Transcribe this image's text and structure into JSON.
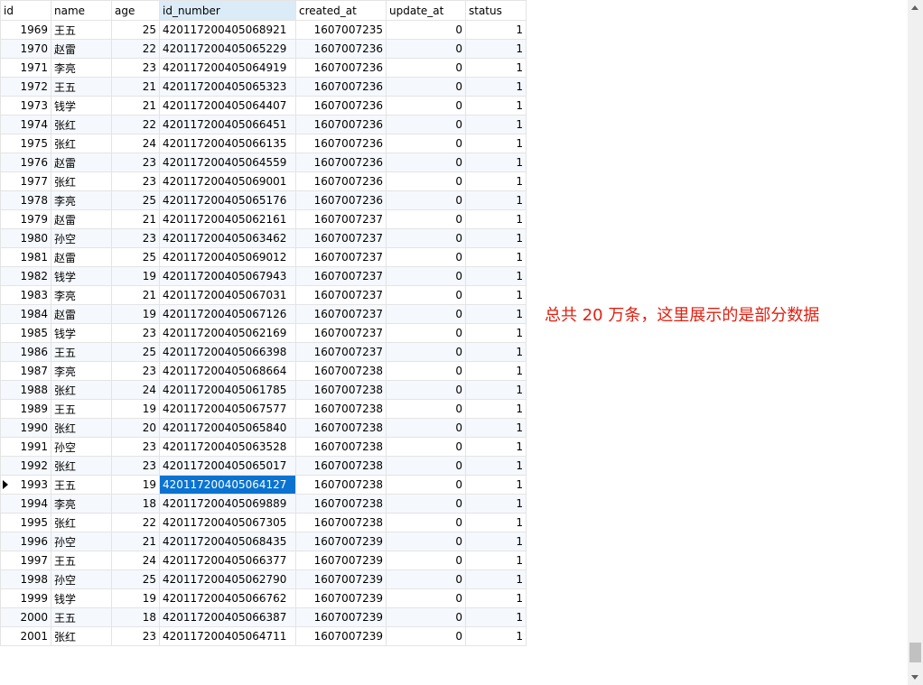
{
  "grid": {
    "columns": [
      "id",
      "name",
      "age",
      "id_number",
      "created_at",
      "update_at",
      "status"
    ],
    "sorted_column_index": 3,
    "current_row_index": 24,
    "selected_cell": {
      "row": 24,
      "col": 3
    },
    "rows": [
      [
        "1969",
        "王五",
        "25",
        "420117200405068921",
        "1607007235",
        "0",
        "1"
      ],
      [
        "1970",
        "赵雷",
        "22",
        "420117200405065229",
        "1607007236",
        "0",
        "1"
      ],
      [
        "1971",
        "李亮",
        "23",
        "420117200405064919",
        "1607007236",
        "0",
        "1"
      ],
      [
        "1972",
        "王五",
        "21",
        "420117200405065323",
        "1607007236",
        "0",
        "1"
      ],
      [
        "1973",
        "钱学",
        "21",
        "420117200405064407",
        "1607007236",
        "0",
        "1"
      ],
      [
        "1974",
        "张红",
        "22",
        "420117200405066451",
        "1607007236",
        "0",
        "1"
      ],
      [
        "1975",
        "张红",
        "24",
        "420117200405066135",
        "1607007236",
        "0",
        "1"
      ],
      [
        "1976",
        "赵雷",
        "23",
        "420117200405064559",
        "1607007236",
        "0",
        "1"
      ],
      [
        "1977",
        "张红",
        "23",
        "420117200405069001",
        "1607007236",
        "0",
        "1"
      ],
      [
        "1978",
        "李亮",
        "25",
        "420117200405065176",
        "1607007236",
        "0",
        "1"
      ],
      [
        "1979",
        "赵雷",
        "21",
        "420117200405062161",
        "1607007237",
        "0",
        "1"
      ],
      [
        "1980",
        "孙空",
        "23",
        "420117200405063462",
        "1607007237",
        "0",
        "1"
      ],
      [
        "1981",
        "赵雷",
        "25",
        "420117200405069012",
        "1607007237",
        "0",
        "1"
      ],
      [
        "1982",
        "钱学",
        "19",
        "420117200405067943",
        "1607007237",
        "0",
        "1"
      ],
      [
        "1983",
        "李亮",
        "21",
        "420117200405067031",
        "1607007237",
        "0",
        "1"
      ],
      [
        "1984",
        "赵雷",
        "19",
        "420117200405067126",
        "1607007237",
        "0",
        "1"
      ],
      [
        "1985",
        "钱学",
        "23",
        "420117200405062169",
        "1607007237",
        "0",
        "1"
      ],
      [
        "1986",
        "王五",
        "25",
        "420117200405066398",
        "1607007237",
        "0",
        "1"
      ],
      [
        "1987",
        "李亮",
        "23",
        "420117200405068664",
        "1607007238",
        "0",
        "1"
      ],
      [
        "1988",
        "张红",
        "24",
        "420117200405061785",
        "1607007238",
        "0",
        "1"
      ],
      [
        "1989",
        "王五",
        "19",
        "420117200405067577",
        "1607007238",
        "0",
        "1"
      ],
      [
        "1990",
        "张红",
        "20",
        "420117200405065840",
        "1607007238",
        "0",
        "1"
      ],
      [
        "1991",
        "孙空",
        "23",
        "420117200405063528",
        "1607007238",
        "0",
        "1"
      ],
      [
        "1992",
        "张红",
        "23",
        "420117200405065017",
        "1607007238",
        "0",
        "1"
      ],
      [
        "1993",
        "王五",
        "19",
        "420117200405064127",
        "1607007238",
        "0",
        "1"
      ],
      [
        "1994",
        "李亮",
        "18",
        "420117200405069889",
        "1607007238",
        "0",
        "1"
      ],
      [
        "1995",
        "张红",
        "22",
        "420117200405067305",
        "1607007238",
        "0",
        "1"
      ],
      [
        "1996",
        "孙空",
        "21",
        "420117200405068435",
        "1607007239",
        "0",
        "1"
      ],
      [
        "1997",
        "王五",
        "24",
        "420117200405066377",
        "1607007239",
        "0",
        "1"
      ],
      [
        "1998",
        "孙空",
        "25",
        "420117200405062790",
        "1607007239",
        "0",
        "1"
      ],
      [
        "1999",
        "钱学",
        "19",
        "420117200405066762",
        "1607007239",
        "0",
        "1"
      ],
      [
        "2000",
        "王五",
        "18",
        "420117200405066387",
        "1607007239",
        "0",
        "1"
      ],
      [
        "2001",
        "张红",
        "23",
        "420117200405064711",
        "1607007239",
        "0",
        "1"
      ]
    ]
  },
  "annotation": {
    "text": "总共  20 万条，这里展示的是部分数据",
    "color": "#e02010"
  },
  "colors": {
    "selection": "#0a73d1",
    "sorted_header": "#dcebf8",
    "alt_row": "#f5f8fc"
  },
  "icons": {
    "current_row_marker": "triangle-right-icon",
    "scroll_up": "arrow-up-icon",
    "scroll_down": "arrow-down-icon"
  }
}
